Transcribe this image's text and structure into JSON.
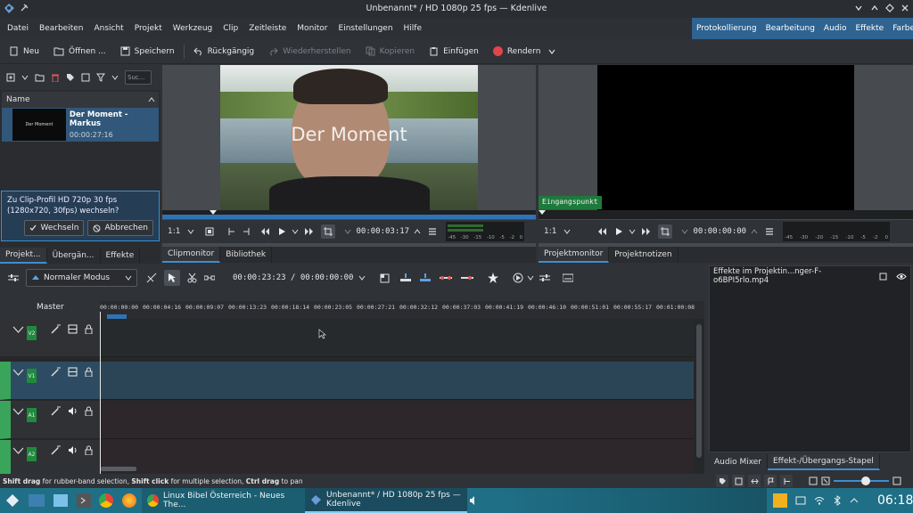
{
  "window": {
    "title": "Unbenannt* / HD 1080p 25 fps — Kdenlive"
  },
  "menu": [
    "Datei",
    "Bearbeiten",
    "Ansicht",
    "Projekt",
    "Werkzeug",
    "Clip",
    "Zeitleiste",
    "Monitor",
    "Einstellungen",
    "Hilfe"
  ],
  "workspaces": [
    "Protokollierung",
    "Bearbeitung",
    "Audio",
    "Effekte",
    "Farbe"
  ],
  "toolbar": {
    "new": "Neu",
    "open": "Öffnen ...",
    "save": "Speichern",
    "undo": "Rückgängig",
    "redo": "Wiederherstellen",
    "copy": "Kopieren",
    "paste": "Einfügen",
    "render": "Rendern"
  },
  "bin": {
    "search_placeholder": "Suc...",
    "column_name": "Name",
    "clip": {
      "thumb_text": "Der Moment",
      "name": "Der Moment - Markus",
      "duration": "00:00:27:16"
    },
    "profile_prompt": "Zu Clip-Profil HD 720p 30 fps (1280x720, 30fps) wechseln?",
    "switch_label": "Wechseln",
    "cancel_label": "Abbrechen",
    "tabs": [
      "Projekt...",
      "Übergän...",
      "Effekte"
    ]
  },
  "clip_monitor": {
    "overlay_text": "Der Moment",
    "zoom": "1:1",
    "timecode": "00:00:03:17",
    "meter_labels": [
      "-45",
      "-30",
      "-15",
      "-10",
      "-5",
      "-2",
      "0"
    ],
    "tabs": [
      "Clipmonitor",
      "Bibliothek"
    ]
  },
  "project_monitor": {
    "in_point_label": "Eingangspunkt",
    "zoom": "1:1",
    "timecode": "00:00:00:00",
    "meter_labels": [
      "-45",
      "-30",
      "-20",
      "-15",
      "-10",
      "-5",
      "-2",
      "0"
    ],
    "tabs": [
      "Projektmonitor",
      "Projektnotizen"
    ]
  },
  "timeline": {
    "mode": "Normaler Modus",
    "position": "00:00:23:23 / 00:00:00:00",
    "master_label": "Master",
    "ruler": [
      "00:00:00:00",
      "00:00:04:16",
      "00:00:09:07",
      "00:00:13:23",
      "00:00:18:14",
      "00:00:23:05",
      "00:00:27:21",
      "00:00:32:12",
      "00:00:37:03",
      "00:00:41:19",
      "00:00:46:10",
      "00:00:51:01",
      "00:00:55:17",
      "00:01:00:08"
    ],
    "tracks": [
      "V2",
      "V1",
      "A1",
      "A2"
    ]
  },
  "effects_panel": {
    "title": "Effekte im Projektin...nger-F-o6BPI5rlo.mp4",
    "tabs": [
      "Audio Mixer",
      "Effekt-/Übergangs-Stapel"
    ]
  },
  "status": {
    "hint_bold1": "Shift drag",
    "hint1": " for rubber-band selection, ",
    "hint_bold2": "Shift click",
    "hint2": " for multiple selection, ",
    "hint_bold3": "Ctrl drag",
    "hint3": " to pan"
  },
  "taskbar": {
    "tasks": [
      "Linux Bibel Österreich - Neues The...",
      "Unbenannt* / HD 1080p 25 fps — Kdenlive"
    ],
    "clock": "06:18"
  }
}
